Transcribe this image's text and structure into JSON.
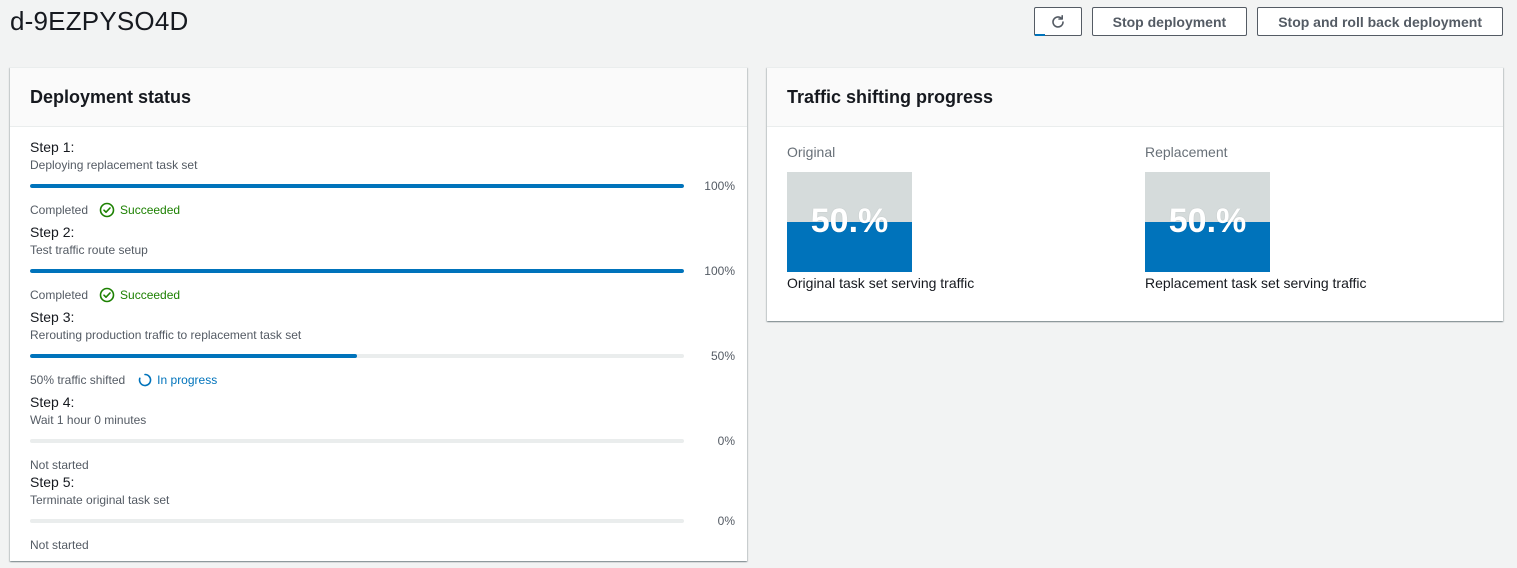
{
  "page": {
    "title": "d-9EZPYSO4D"
  },
  "header": {
    "refresh_icon": "refresh-icon",
    "stop_label": "Stop deployment",
    "rollback_label": "Stop and roll back deployment"
  },
  "deployment_status": {
    "title": "Deployment status",
    "steps": [
      {
        "title": "Step 1:",
        "description": "Deploying replacement task set",
        "progress": 100,
        "progress_label": "100%",
        "status_text": "Completed",
        "badge": "Succeeded",
        "badge_type": "success"
      },
      {
        "title": "Step 2:",
        "description": "Test traffic route setup",
        "progress": 100,
        "progress_label": "100%",
        "status_text": "Completed",
        "badge": "Succeeded",
        "badge_type": "success"
      },
      {
        "title": "Step 3:",
        "description": "Rerouting production traffic to replacement task set",
        "progress": 50,
        "progress_label": "50%",
        "status_text": "50% traffic shifted",
        "badge": "In progress",
        "badge_type": "progress"
      },
      {
        "title": "Step 4:",
        "description": "Wait 1 hour 0 minutes",
        "progress": 0,
        "progress_label": "0%",
        "status_text": "Not started",
        "badge": "",
        "badge_type": "none"
      },
      {
        "title": "Step 5:",
        "description": "Terminate original task set",
        "progress": 0,
        "progress_label": "0%",
        "status_text": "Not started",
        "badge": "",
        "badge_type": "none"
      }
    ]
  },
  "traffic": {
    "title": "Traffic shifting progress",
    "original": {
      "label": "Original",
      "percent": 50,
      "percent_label": "50.%",
      "caption": "Original task set serving traffic"
    },
    "replacement": {
      "label": "Replacement",
      "percent": 50,
      "percent_label": "50.%",
      "caption": "Replacement task set serving traffic"
    }
  },
  "colors": {
    "accent": "#0073bb",
    "success": "#1d8102",
    "track": "#eaeded",
    "gauge_bg": "#d5dbdb"
  }
}
